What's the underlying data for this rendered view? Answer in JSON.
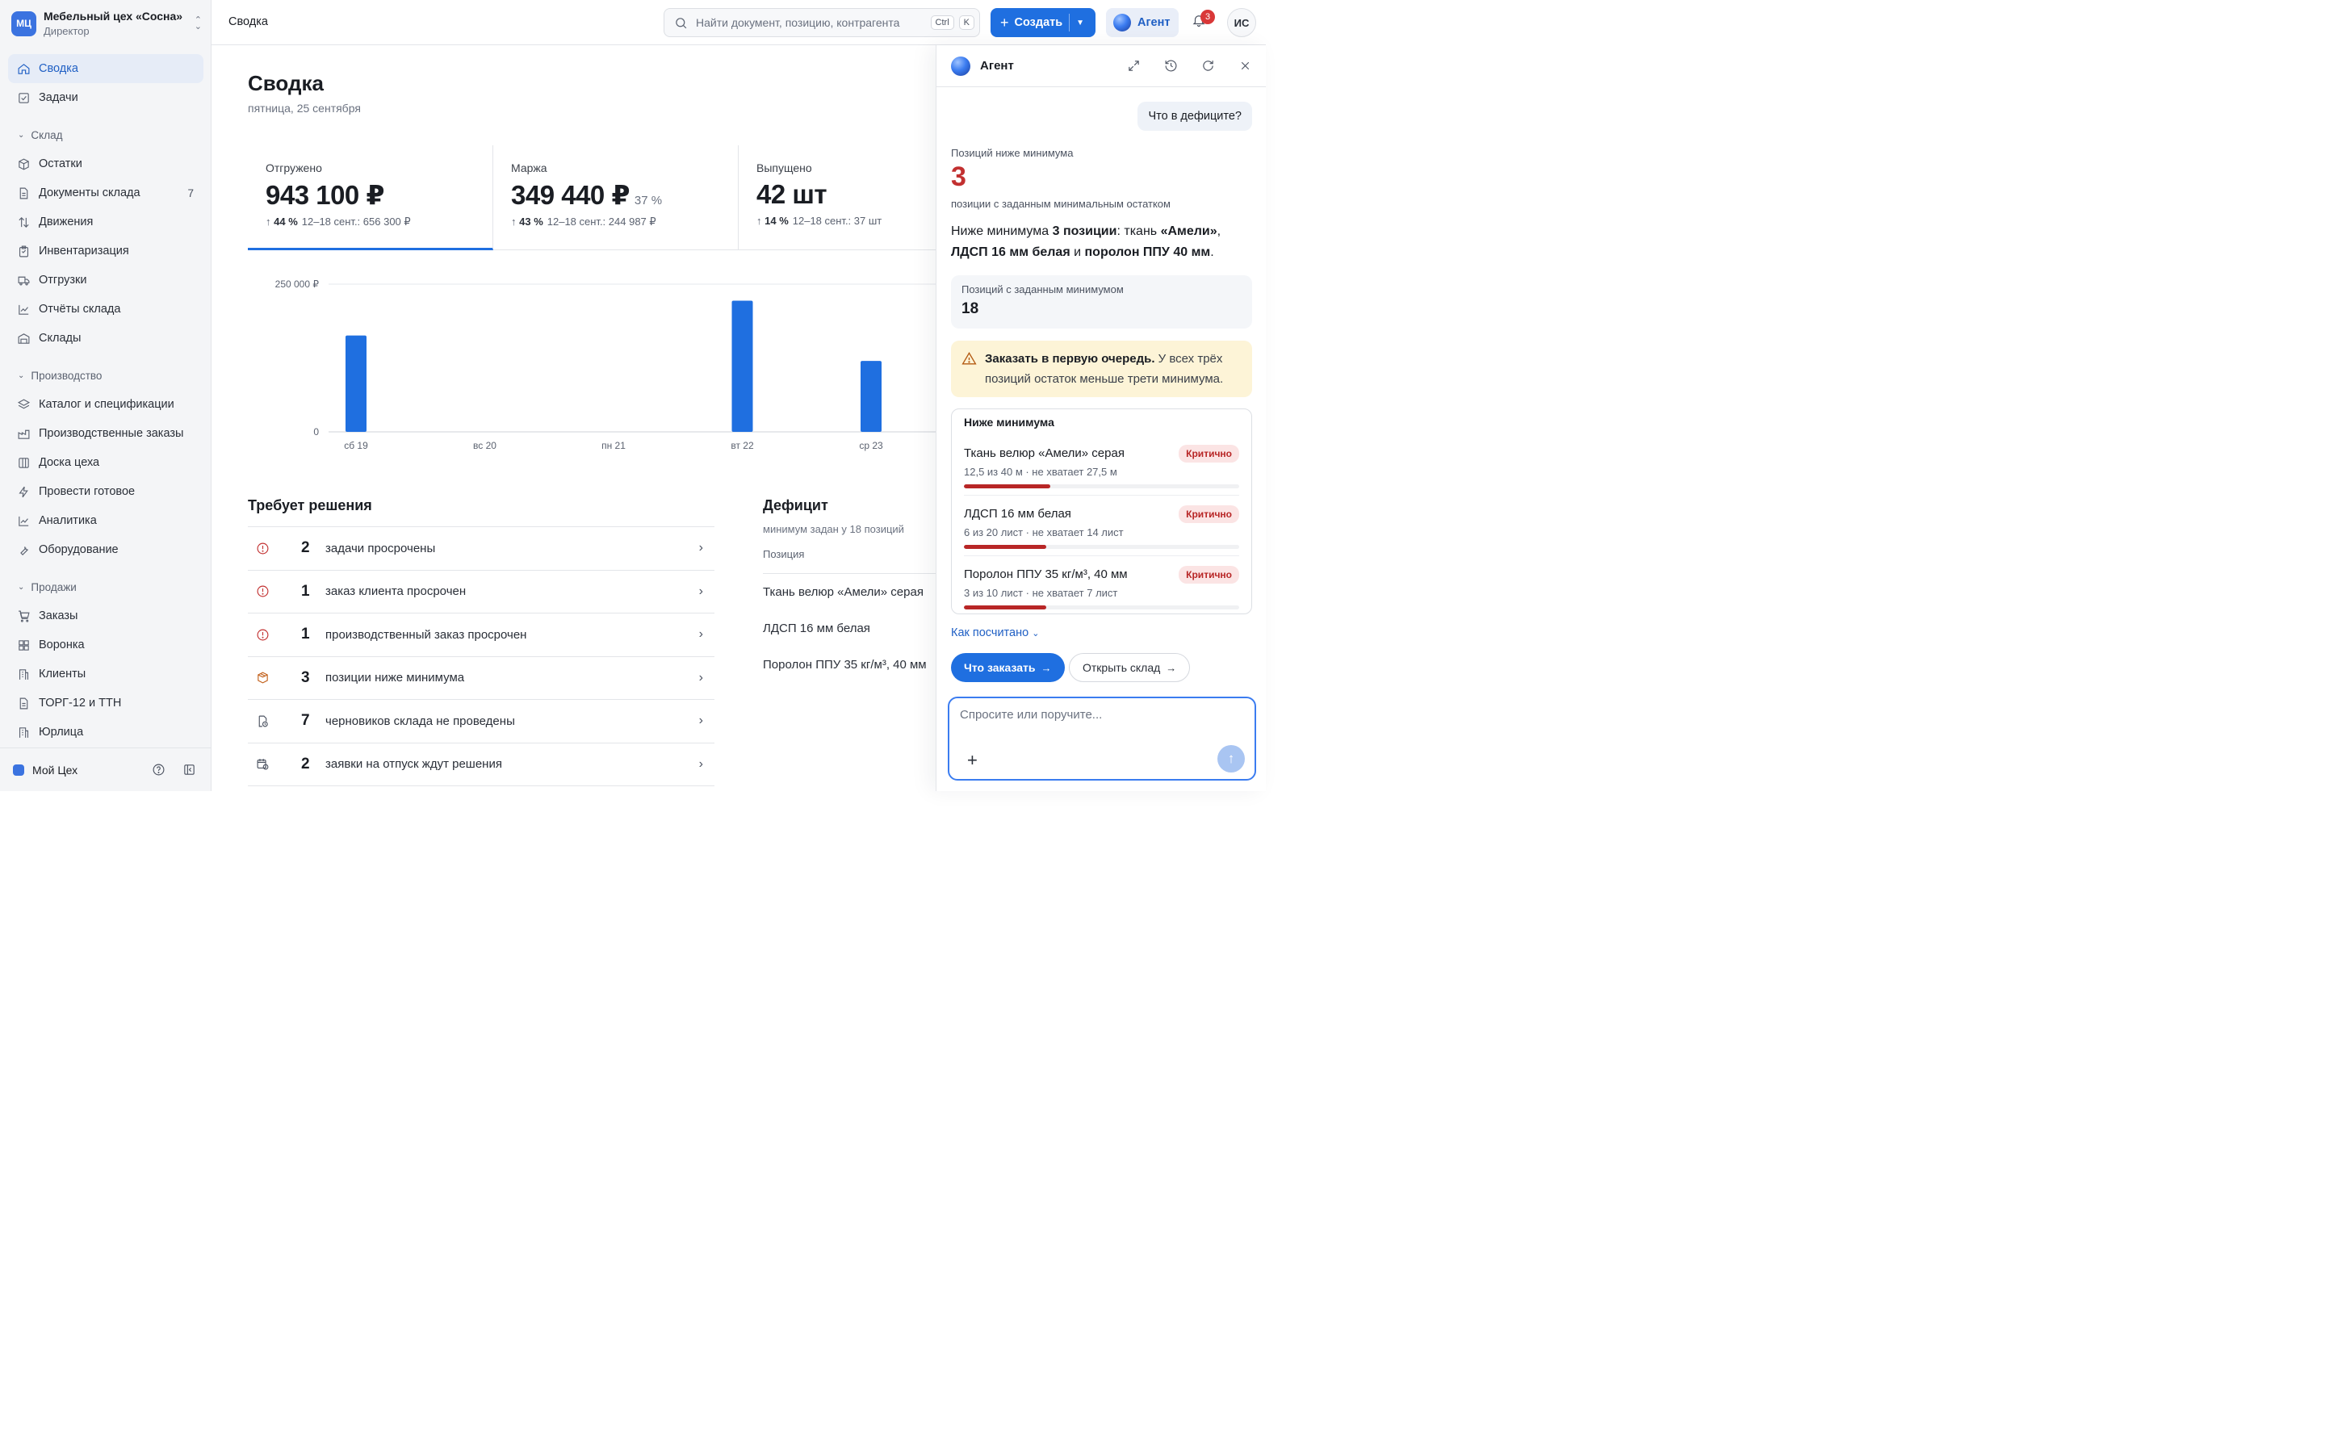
{
  "org": {
    "initials": "МЦ",
    "name": "Мебельный цех «Сосна»",
    "role": "Директор"
  },
  "nav": {
    "top": [
      {
        "label": "Сводка",
        "icon": "home-icon",
        "active": true
      },
      {
        "label": "Задачи",
        "icon": "checkbox-icon"
      }
    ],
    "groups": [
      {
        "title": "Склад",
        "items": [
          {
            "label": "Остатки",
            "icon": "box-icon"
          },
          {
            "label": "Документы склада",
            "icon": "document-icon",
            "count": "7"
          },
          {
            "label": "Движения",
            "icon": "arrows-updown-icon"
          },
          {
            "label": "Инвентаризация",
            "icon": "clipboard-icon"
          },
          {
            "label": "Отгрузки",
            "icon": "truck-icon"
          },
          {
            "label": "Отчёты склада",
            "icon": "line-chart-icon"
          },
          {
            "label": "Склады",
            "icon": "warehouse-icon"
          }
        ]
      },
      {
        "title": "Производство",
        "items": [
          {
            "label": "Каталог и спецификации",
            "icon": "layers-icon"
          },
          {
            "label": "Производственные заказы",
            "icon": "factory-icon"
          },
          {
            "label": "Доска цеха",
            "icon": "columns-icon"
          },
          {
            "label": "Провести готовое",
            "icon": "lightning-icon"
          },
          {
            "label": "Аналитика",
            "icon": "line-chart-icon"
          },
          {
            "label": "Оборудование",
            "icon": "wrench-icon"
          }
        ]
      },
      {
        "title": "Продажи",
        "items": [
          {
            "label": "Заказы",
            "icon": "cart-icon"
          },
          {
            "label": "Воронка",
            "icon": "grid-icon"
          },
          {
            "label": "Клиенты",
            "icon": "building-icon"
          },
          {
            "label": "ТОРГ-12 и ТТН",
            "icon": "document-icon"
          },
          {
            "label": "Юрлица",
            "icon": "building-icon"
          }
        ]
      }
    ]
  },
  "footer": {
    "workspace": "Мой Цех"
  },
  "topbar": {
    "breadcrumb": "Сводка",
    "search_placeholder": "Найти документ, позицию, контрагента",
    "kbd1": "Ctrl",
    "kbd2": "K",
    "create_label": "Создать",
    "agent_label": "Агент",
    "notif_count": "3",
    "user_initials": "ИС"
  },
  "page": {
    "title": "Сводка",
    "date": "пятница, 25 сентября"
  },
  "kpis": [
    {
      "label": "Отгружено",
      "value": "943 100 ₽",
      "sub": "",
      "delta": "44 %",
      "compare": "12–18 сент.: 656 300 ₽",
      "active": true
    },
    {
      "label": "Маржа",
      "value": "349 440 ₽",
      "sub": "37 %",
      "delta": "43 %",
      "compare": "12–18 сент.: 244 987 ₽"
    },
    {
      "label": "Выпущено",
      "value": "42 шт",
      "sub": "",
      "delta": "14 %",
      "compare": "12–18 сент.: 37 шт"
    }
  ],
  "chart_data": {
    "type": "bar",
    "categories": [
      "сб 19",
      "вс 20",
      "пн 21",
      "вт 22",
      "ср 23"
    ],
    "values": [
      163000,
      0,
      0,
      222000,
      120000
    ],
    "yticks": [
      "0",
      "250 000 ₽"
    ],
    "ylim": [
      0,
      250000
    ],
    "color": "#1f6fe0",
    "grid": true
  },
  "decisions": {
    "title": "Требует решения",
    "rows": [
      {
        "num": "2",
        "text": "задачи просрочены",
        "icon": "alert-circle-icon",
        "color": "#c23030"
      },
      {
        "num": "1",
        "text": "заказ клиента просрочен",
        "icon": "alert-circle-icon",
        "color": "#c23030"
      },
      {
        "num": "1",
        "text": "производственный заказ просрочен",
        "icon": "alert-circle-icon",
        "color": "#c23030"
      },
      {
        "num": "3",
        "text": "позиции ниже минимума",
        "icon": "package-icon",
        "color": "#c2601a"
      },
      {
        "num": "7",
        "text": "черновиков склада не проведены",
        "icon": "file-clock-icon",
        "color": "#4b5260"
      },
      {
        "num": "2",
        "text": "заявки на отпуск ждут решения",
        "icon": "calendar-clock-icon",
        "color": "#4b5260"
      }
    ]
  },
  "deficit": {
    "title": "Дефицит",
    "subtitle": "минимум задан у 18 позиций",
    "col_header": "Позиция",
    "rows": [
      "Ткань велюр «Амели» серая",
      "ЛДСП 16 мм белая",
      "Поролон ППУ 35 кг/м³, 40 мм"
    ]
  },
  "agent": {
    "title": "Агент",
    "user_message": "Что в дефиците?",
    "metric_label": "Позиций ниже минимума",
    "metric_value": "3",
    "metric_caption": "позиции с заданным минимальным остатком",
    "para": [
      "Ниже минимума ",
      "3 позиции",
      ": ткань ",
      "«Амели»",
      ", ",
      "ЛДСП 16 мм белая",
      " и ",
      "поролон ППУ 40 мм",
      "."
    ],
    "stat_label": "Позиций с заданным минимумом",
    "stat_value": "18",
    "warn_bold": "Заказать в первую очередь.",
    "warn_text": " У всех трёх позиций остаток меньше трети минимума.",
    "card_title": "Ниже минимума",
    "items": [
      {
        "name": "Ткань велюр «Амели» серая",
        "meta": "12,5 из 40 м · не хватает 27,5 м",
        "badge": "Критично",
        "fill": 0.3125
      },
      {
        "name": "ЛДСП 16 мм белая",
        "meta": "6 из 20 лист · не хватает 14 лист",
        "badge": "Критично",
        "fill": 0.3
      },
      {
        "name": "Поролон ППУ 35 кг/м³, 40 мм",
        "meta": "3 из 10 лист · не хватает 7 лист",
        "badge": "Критично",
        "fill": 0.3
      }
    ],
    "how_label": "Как посчитано",
    "btn_primary": "Что заказать",
    "btn_secondary": "Открыть склад",
    "composer_placeholder": "Спросите или поручите..."
  }
}
